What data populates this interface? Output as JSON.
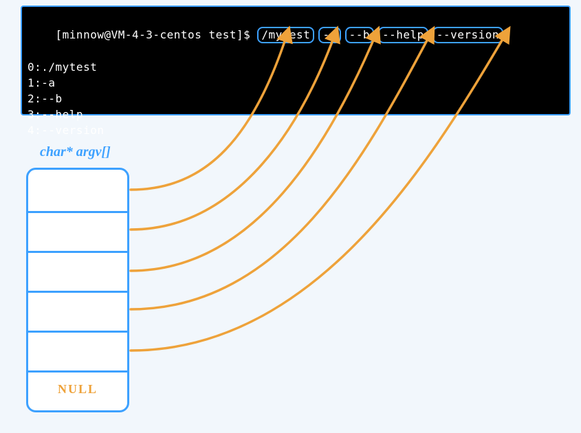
{
  "diagram": {
    "argv_label": "char* argv[]",
    "null_label": "NULL"
  },
  "terminal": {
    "prompt": "[minnow@VM-4-3-centos test]$ ",
    "command_tokens": [
      "/mytest",
      "-a",
      "--b",
      "--help",
      "--version"
    ],
    "output_lines": [
      "0:./mytest",
      "1:-a",
      "2:--b",
      "3:--help",
      "4:--version"
    ]
  },
  "colors": {
    "terminal_bg": "#000000",
    "border_blue": "#3da1ff",
    "arrow_orange": "#eea23a",
    "page_bg": "#f2f7fc"
  },
  "chart_data": {
    "type": "diagram",
    "description": "Illustration of argc/argv: a shell command with 5 tokens mapping to entries of the char* argv[] array, with a sixth entry being NULL.",
    "argv": [
      "./mytest",
      "-a",
      "--b",
      "--help",
      "--version",
      null
    ],
    "argc": 5
  }
}
